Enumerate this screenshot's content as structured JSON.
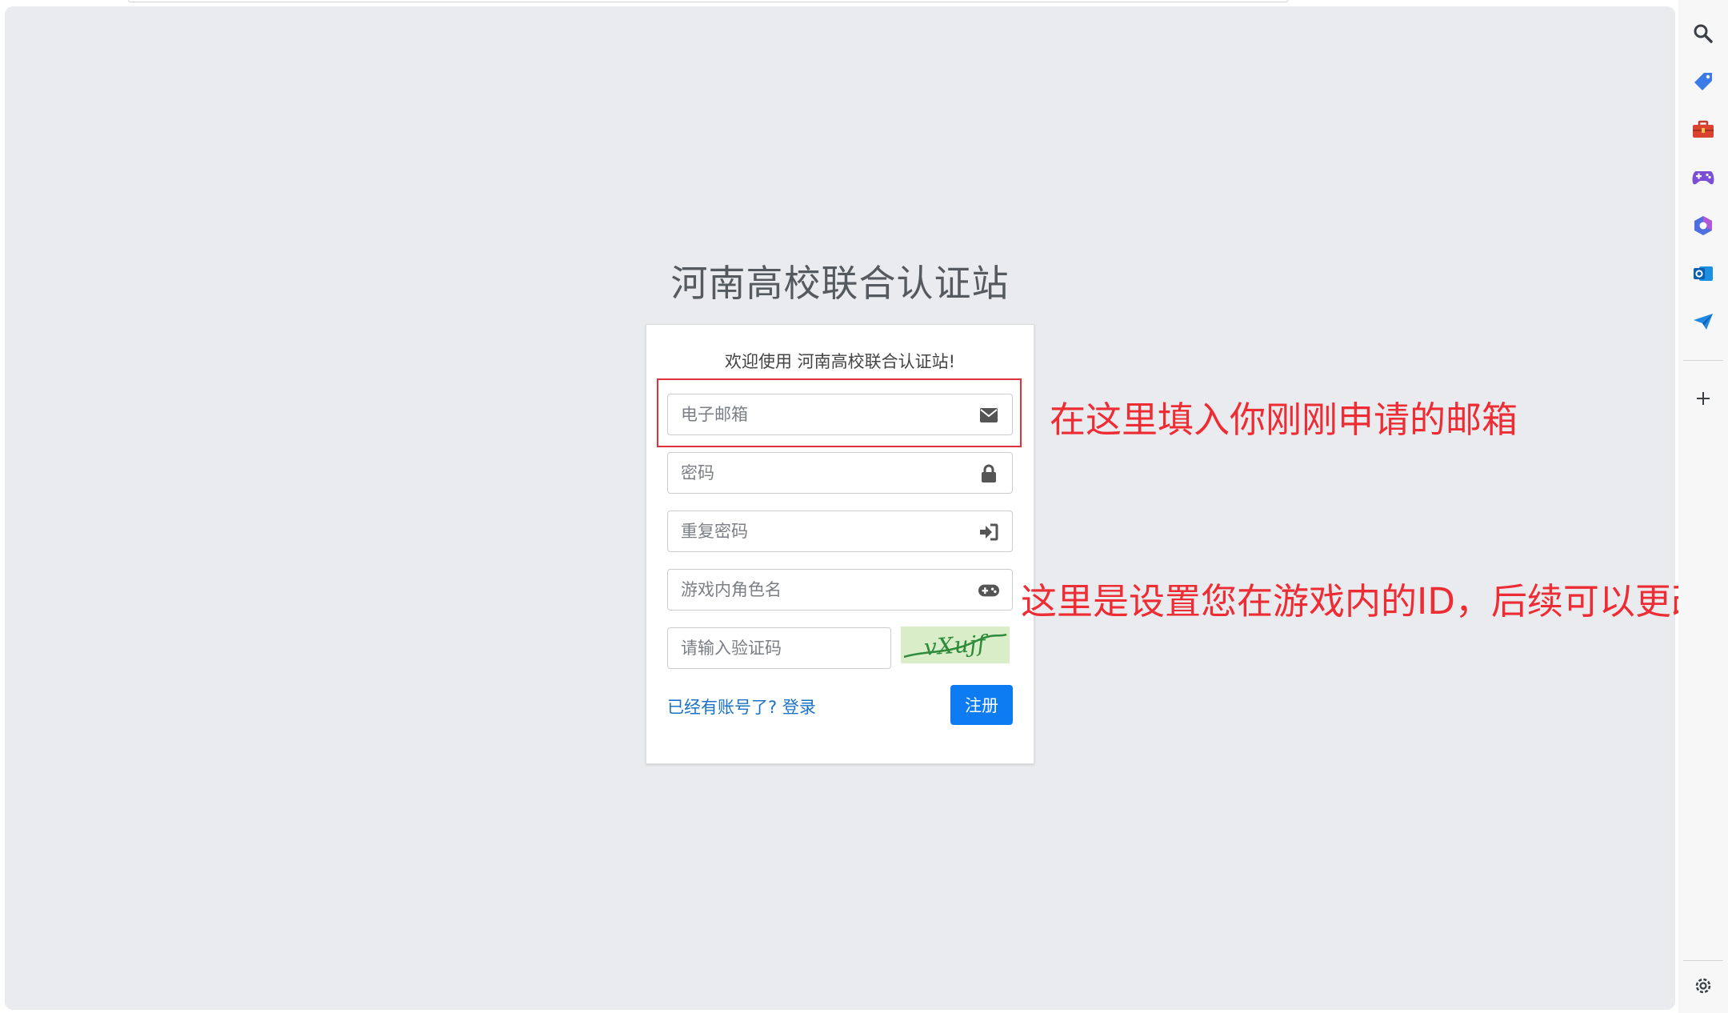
{
  "site": {
    "title": "河南高校联合认证站",
    "welcome": "欢迎使用 河南高校联合认证站!"
  },
  "form": {
    "email_placeholder": "电子邮箱",
    "password_placeholder": "密码",
    "repeat_password_placeholder": "重复密码",
    "game_name_placeholder": "游戏内角色名",
    "captcha_placeholder": "请输入验证码",
    "captcha_text": "vXujf",
    "login_link": "已经有账号了? 登录",
    "register_button": "注册"
  },
  "annotations": {
    "email_note": "在这里填入你刚刚申请的邮箱",
    "game_id_note": "这里是设置您在游戏内的ID，后续可以更改"
  },
  "sidebar": {
    "icons": [
      "search-icon",
      "tag-icon",
      "toolbox-icon",
      "gamepad-icon",
      "copilot-icon",
      "outlook-icon",
      "send-icon",
      "plus-icon",
      "gear-icon"
    ]
  },
  "colors": {
    "accent": "#0d7cf2",
    "annotation": "#ee2c34",
    "page_bg": "#e9ebee",
    "captcha_bg": "#d9edc8"
  }
}
